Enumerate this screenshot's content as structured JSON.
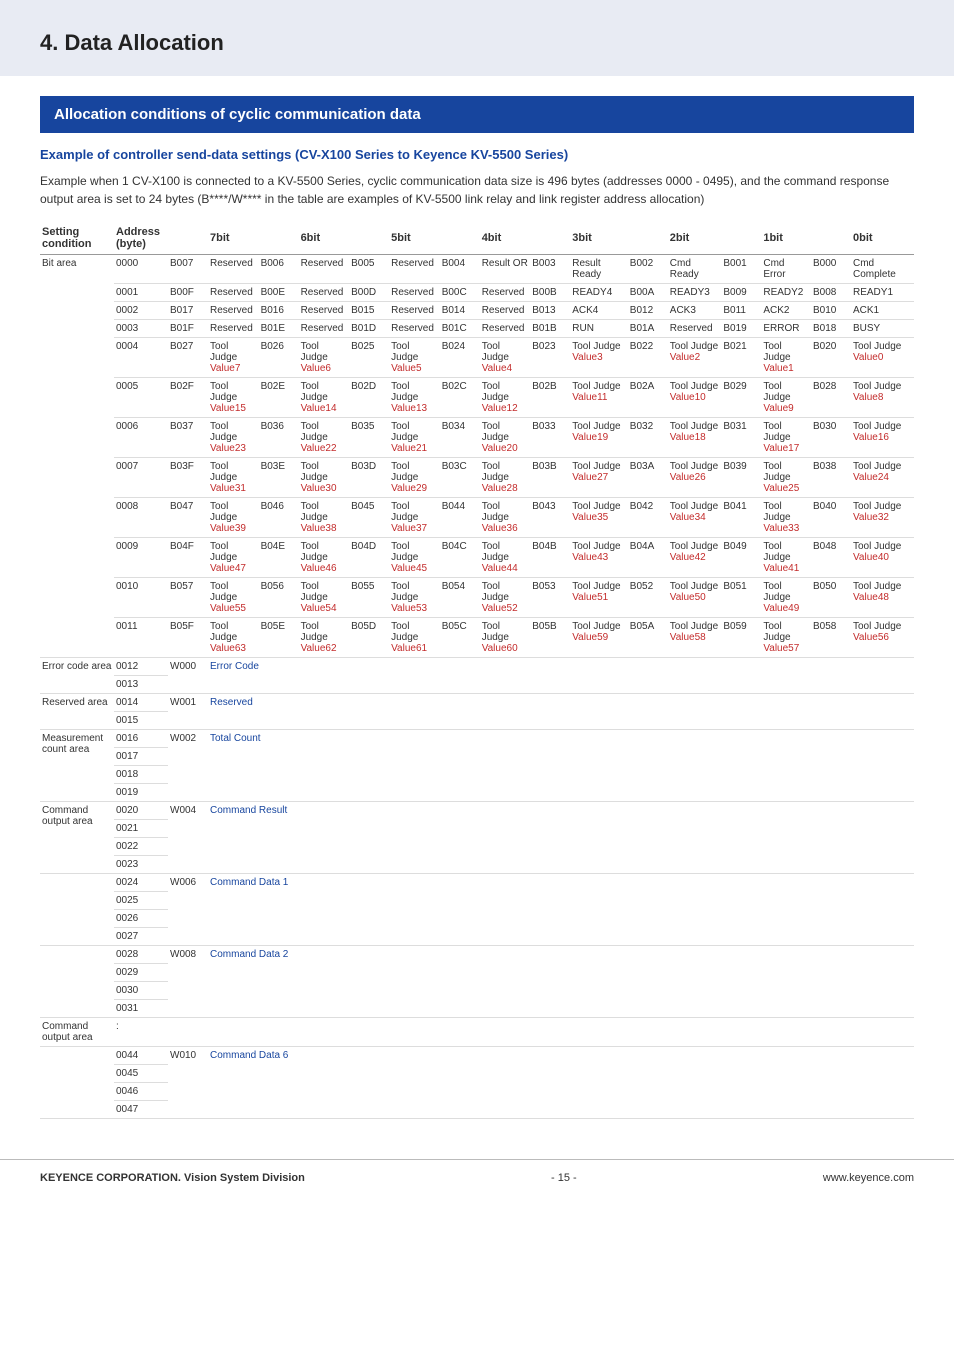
{
  "banner_title": "4. Data Allocation",
  "section_title": "Allocation conditions of cyclic communication data",
  "example_title": "Example of controller send-data settings (CV-X100 Series to Keyence   KV-5500 Series)",
  "intro": "Example when 1 CV-X100 is connected to a KV-5500 Series, cyclic communication data size is 496 bytes (addresses 0000 - 0495), and the command response output area is set to 24 bytes (B****/W**** in the table are examples of KV-5500 link relay and link register address allocation)",
  "headers": {
    "h0": "Setting condition",
    "h1": "Address (byte)",
    "h2": "7bit",
    "h3": "6bit",
    "h4": "5bit",
    "h5": "4bit",
    "h6": "3bit",
    "h7": "2bit",
    "h8": "1bit",
    "h9": "0bit"
  },
  "bit": {
    "sc": "Bit area",
    "rows": [
      {
        "addr": "0000",
        "c": "B007",
        "cells": [
          [
            "Reserved",
            ""
          ],
          [
            "B006",
            "Reserved",
            ""
          ],
          [
            "B005",
            "Reserved",
            ""
          ],
          [
            "B004",
            "Result OR",
            ""
          ],
          [
            "B003",
            "Result Ready",
            ""
          ],
          [
            "B002",
            "Cmd Ready",
            ""
          ],
          [
            "B001",
            "Cmd Error",
            ""
          ],
          [
            "B000",
            "Cmd Complete",
            ""
          ]
        ]
      },
      {
        "addr": "0001",
        "c": "B00F",
        "cells": [
          [
            "Reserved",
            ""
          ],
          [
            "B00E",
            "Reserved",
            ""
          ],
          [
            "B00D",
            "Reserved",
            ""
          ],
          [
            "B00C",
            "Reserved",
            ""
          ],
          [
            "B00B",
            "READY4",
            ""
          ],
          [
            "B00A",
            "READY3",
            ""
          ],
          [
            "B009",
            "READY2",
            ""
          ],
          [
            "B008",
            "READY1",
            ""
          ]
        ]
      },
      {
        "addr": "0002",
        "c": "B017",
        "cells": [
          [
            "Reserved",
            ""
          ],
          [
            "B016",
            "Reserved",
            ""
          ],
          [
            "B015",
            "Reserved",
            ""
          ],
          [
            "B014",
            "Reserved",
            ""
          ],
          [
            "B013",
            "ACK4",
            ""
          ],
          [
            "B012",
            "ACK3",
            ""
          ],
          [
            "B011",
            "ACK2",
            ""
          ],
          [
            "B010",
            "ACK1",
            ""
          ]
        ]
      },
      {
        "addr": "0003",
        "c": "B01F",
        "cells": [
          [
            "Reserved",
            ""
          ],
          [
            "B01E",
            "Reserved",
            ""
          ],
          [
            "B01D",
            "Reserved",
            ""
          ],
          [
            "B01C",
            "Reserved",
            ""
          ],
          [
            "B01B",
            "RUN",
            ""
          ],
          [
            "B01A",
            "Reserved",
            ""
          ],
          [
            "B019",
            "ERROR",
            ""
          ],
          [
            "B018",
            "BUSY",
            ""
          ]
        ]
      },
      {
        "addr": "0004",
        "c": "B027",
        "cells": [
          [
            "Tool Judge",
            "Value7"
          ],
          [
            "B026",
            "Tool Judge",
            "Value6"
          ],
          [
            "B025",
            "Tool Judge",
            "Value5"
          ],
          [
            "B024",
            "Tool Judge",
            "Value4"
          ],
          [
            "B023",
            "Tool Judge",
            "Value3"
          ],
          [
            "B022",
            "Tool Judge",
            "Value2"
          ],
          [
            "B021",
            "Tool Judge",
            "Value1"
          ],
          [
            "B020",
            "Tool Judge",
            "Value0"
          ]
        ]
      },
      {
        "addr": "0005",
        "c": "B02F",
        "cells": [
          [
            "Tool Judge",
            "Value15"
          ],
          [
            "B02E",
            "Tool Judge",
            "Value14"
          ],
          [
            "B02D",
            "Tool Judge",
            "Value13"
          ],
          [
            "B02C",
            "Tool Judge",
            "Value12"
          ],
          [
            "B02B",
            "Tool Judge",
            "Value11"
          ],
          [
            "B02A",
            "Tool Judge",
            "Value10"
          ],
          [
            "B029",
            "Tool Judge",
            "Value9"
          ],
          [
            "B028",
            "Tool Judge",
            "Value8"
          ]
        ]
      },
      {
        "addr": "0006",
        "c": "B037",
        "cells": [
          [
            "Tool Judge",
            "Value23"
          ],
          [
            "B036",
            "Tool Judge",
            "Value22"
          ],
          [
            "B035",
            "Tool Judge",
            "Value21"
          ],
          [
            "B034",
            "Tool Judge",
            "Value20"
          ],
          [
            "B033",
            "Tool Judge",
            "Value19"
          ],
          [
            "B032",
            "Tool Judge",
            "Value18"
          ],
          [
            "B031",
            "Tool Judge",
            "Value17"
          ],
          [
            "B030",
            "Tool Judge",
            "Value16"
          ]
        ]
      },
      {
        "addr": "0007",
        "c": "B03F",
        "cells": [
          [
            "Tool Judge",
            "Value31"
          ],
          [
            "B03E",
            "Tool Judge",
            "Value30"
          ],
          [
            "B03D",
            "Tool Judge",
            "Value29"
          ],
          [
            "B03C",
            "Tool Judge",
            "Value28"
          ],
          [
            "B03B",
            "Tool Judge",
            "Value27"
          ],
          [
            "B03A",
            "Tool Judge",
            "Value26"
          ],
          [
            "B039",
            "Tool Judge",
            "Value25"
          ],
          [
            "B038",
            "Tool Judge",
            "Value24"
          ]
        ]
      },
      {
        "addr": "0008",
        "c": "B047",
        "cells": [
          [
            "Tool Judge",
            "Value39"
          ],
          [
            "B046",
            "Tool Judge",
            "Value38"
          ],
          [
            "B045",
            "Tool Judge",
            "Value37"
          ],
          [
            "B044",
            "Tool Judge",
            "Value36"
          ],
          [
            "B043",
            "Tool Judge",
            "Value35"
          ],
          [
            "B042",
            "Tool Judge",
            "Value34"
          ],
          [
            "B041",
            "Tool Judge",
            "Value33"
          ],
          [
            "B040",
            "Tool Judge",
            "Value32"
          ]
        ]
      },
      {
        "addr": "0009",
        "c": "B04F",
        "cells": [
          [
            "Tool Judge",
            "Value47"
          ],
          [
            "B04E",
            "Tool Judge",
            "Value46"
          ],
          [
            "B04D",
            "Tool Judge",
            "Value45"
          ],
          [
            "B04C",
            "Tool Judge",
            "Value44"
          ],
          [
            "B04B",
            "Tool Judge",
            "Value43"
          ],
          [
            "B04A",
            "Tool Judge",
            "Value42"
          ],
          [
            "B049",
            "Tool Judge",
            "Value41"
          ],
          [
            "B048",
            "Tool Judge",
            "Value40"
          ]
        ]
      },
      {
        "addr": "0010",
        "c": "B057",
        "cells": [
          [
            "Tool Judge",
            "Value55"
          ],
          [
            "B056",
            "Tool Judge",
            "Value54"
          ],
          [
            "B055",
            "Tool Judge",
            "Value53"
          ],
          [
            "B054",
            "Tool Judge",
            "Value52"
          ],
          [
            "B053",
            "Tool Judge",
            "Value51"
          ],
          [
            "B052",
            "Tool Judge",
            "Value50"
          ],
          [
            "B051",
            "Tool Judge",
            "Value49"
          ],
          [
            "B050",
            "Tool Judge",
            "Value48"
          ]
        ]
      },
      {
        "addr": "0011",
        "c": "B05F",
        "cells": [
          [
            "Tool Judge",
            "Value63"
          ],
          [
            "B05E",
            "Tool Judge",
            "Value62"
          ],
          [
            "B05D",
            "Tool Judge",
            "Value61"
          ],
          [
            "B05C",
            "Tool Judge",
            "Value60"
          ],
          [
            "B05B",
            "Tool Judge",
            "Value59"
          ],
          [
            "B05A",
            "Tool Judge",
            "Value58"
          ],
          [
            "B059",
            "Tool Judge",
            "Value57"
          ],
          [
            "B058",
            "Tool Judge",
            "Value56"
          ]
        ]
      }
    ]
  },
  "groups": [
    {
      "sc": "Error code area",
      "code": "W000",
      "label": "Error Code",
      "addrs": [
        "0012",
        "0013"
      ]
    },
    {
      "sc": "Reserved area",
      "code": "W001",
      "label": "Reserved",
      "addrs": [
        "0014",
        "0015"
      ]
    },
    {
      "sc": "Measurement count area",
      "code": "W002",
      "label": "Total Count",
      "addrs": [
        "0016",
        "0017",
        "0018",
        "0019"
      ]
    },
    {
      "sc": "Command output area",
      "code": "W004",
      "label": "Command Result",
      "addrs": [
        "0020",
        "0021",
        "0022",
        "0023"
      ]
    },
    {
      "sc": "",
      "code": "W006",
      "label": "Command Data 1",
      "addrs": [
        "0024",
        "0025",
        "0026",
        "0027"
      ]
    },
    {
      "sc": "",
      "code": "W008",
      "label": "Command Data 2",
      "addrs": [
        "0028",
        "0029",
        "0030",
        "0031"
      ]
    },
    {
      "sc": "Command output area",
      "code": "",
      "label": "",
      "addrs": [
        ":"
      ]
    },
    {
      "sc": "",
      "code": "W010",
      "label": "Command Data 6",
      "addrs": [
        "0044",
        "0045",
        "0046",
        "0047"
      ]
    }
  ],
  "footer": {
    "l": "KEYENCE CORPORATION. Vision System Division",
    "c": "- 15 -",
    "r": "www.keyence.com"
  }
}
